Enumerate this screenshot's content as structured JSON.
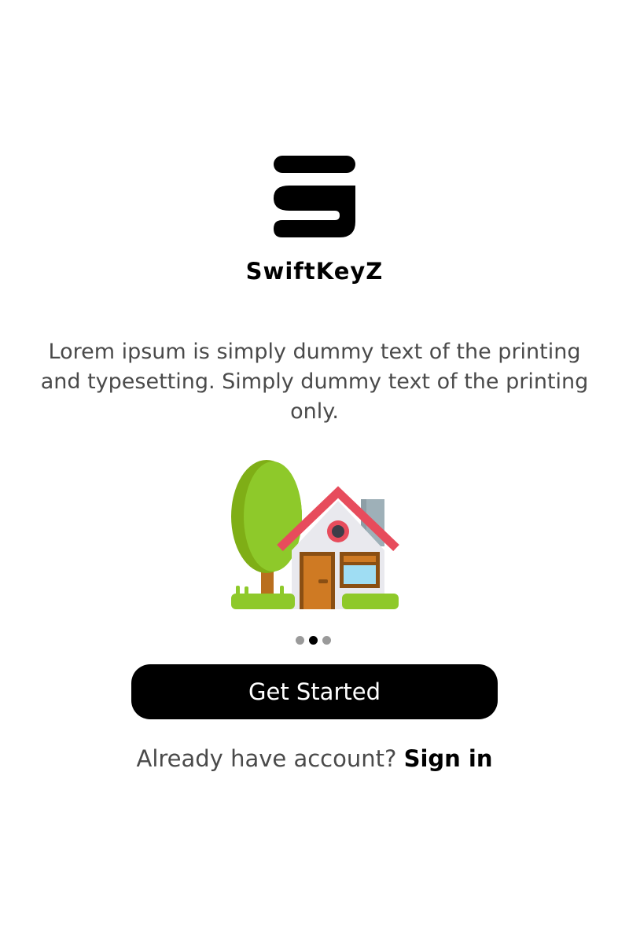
{
  "brand": {
    "logo_icon": "swiftkeyz-logo-icon",
    "name": "SwiftKeyZ"
  },
  "onboarding": {
    "description": "Lorem ipsum is simply dummy text of the printing and typesetting. Simply dummy text of the printing only.",
    "illustration_icon": "house-with-tree-illustration",
    "pager": {
      "total": 3,
      "active_index": 1
    }
  },
  "actions": {
    "get_started_label": "Get Started",
    "signin_prompt": "Already have account?",
    "signin_label": "Sign in"
  },
  "colors": {
    "primary": "#000000",
    "background": "#ffffff",
    "text_secondary": "#4a4a4a",
    "dot_inactive": "#9a9a9a"
  }
}
